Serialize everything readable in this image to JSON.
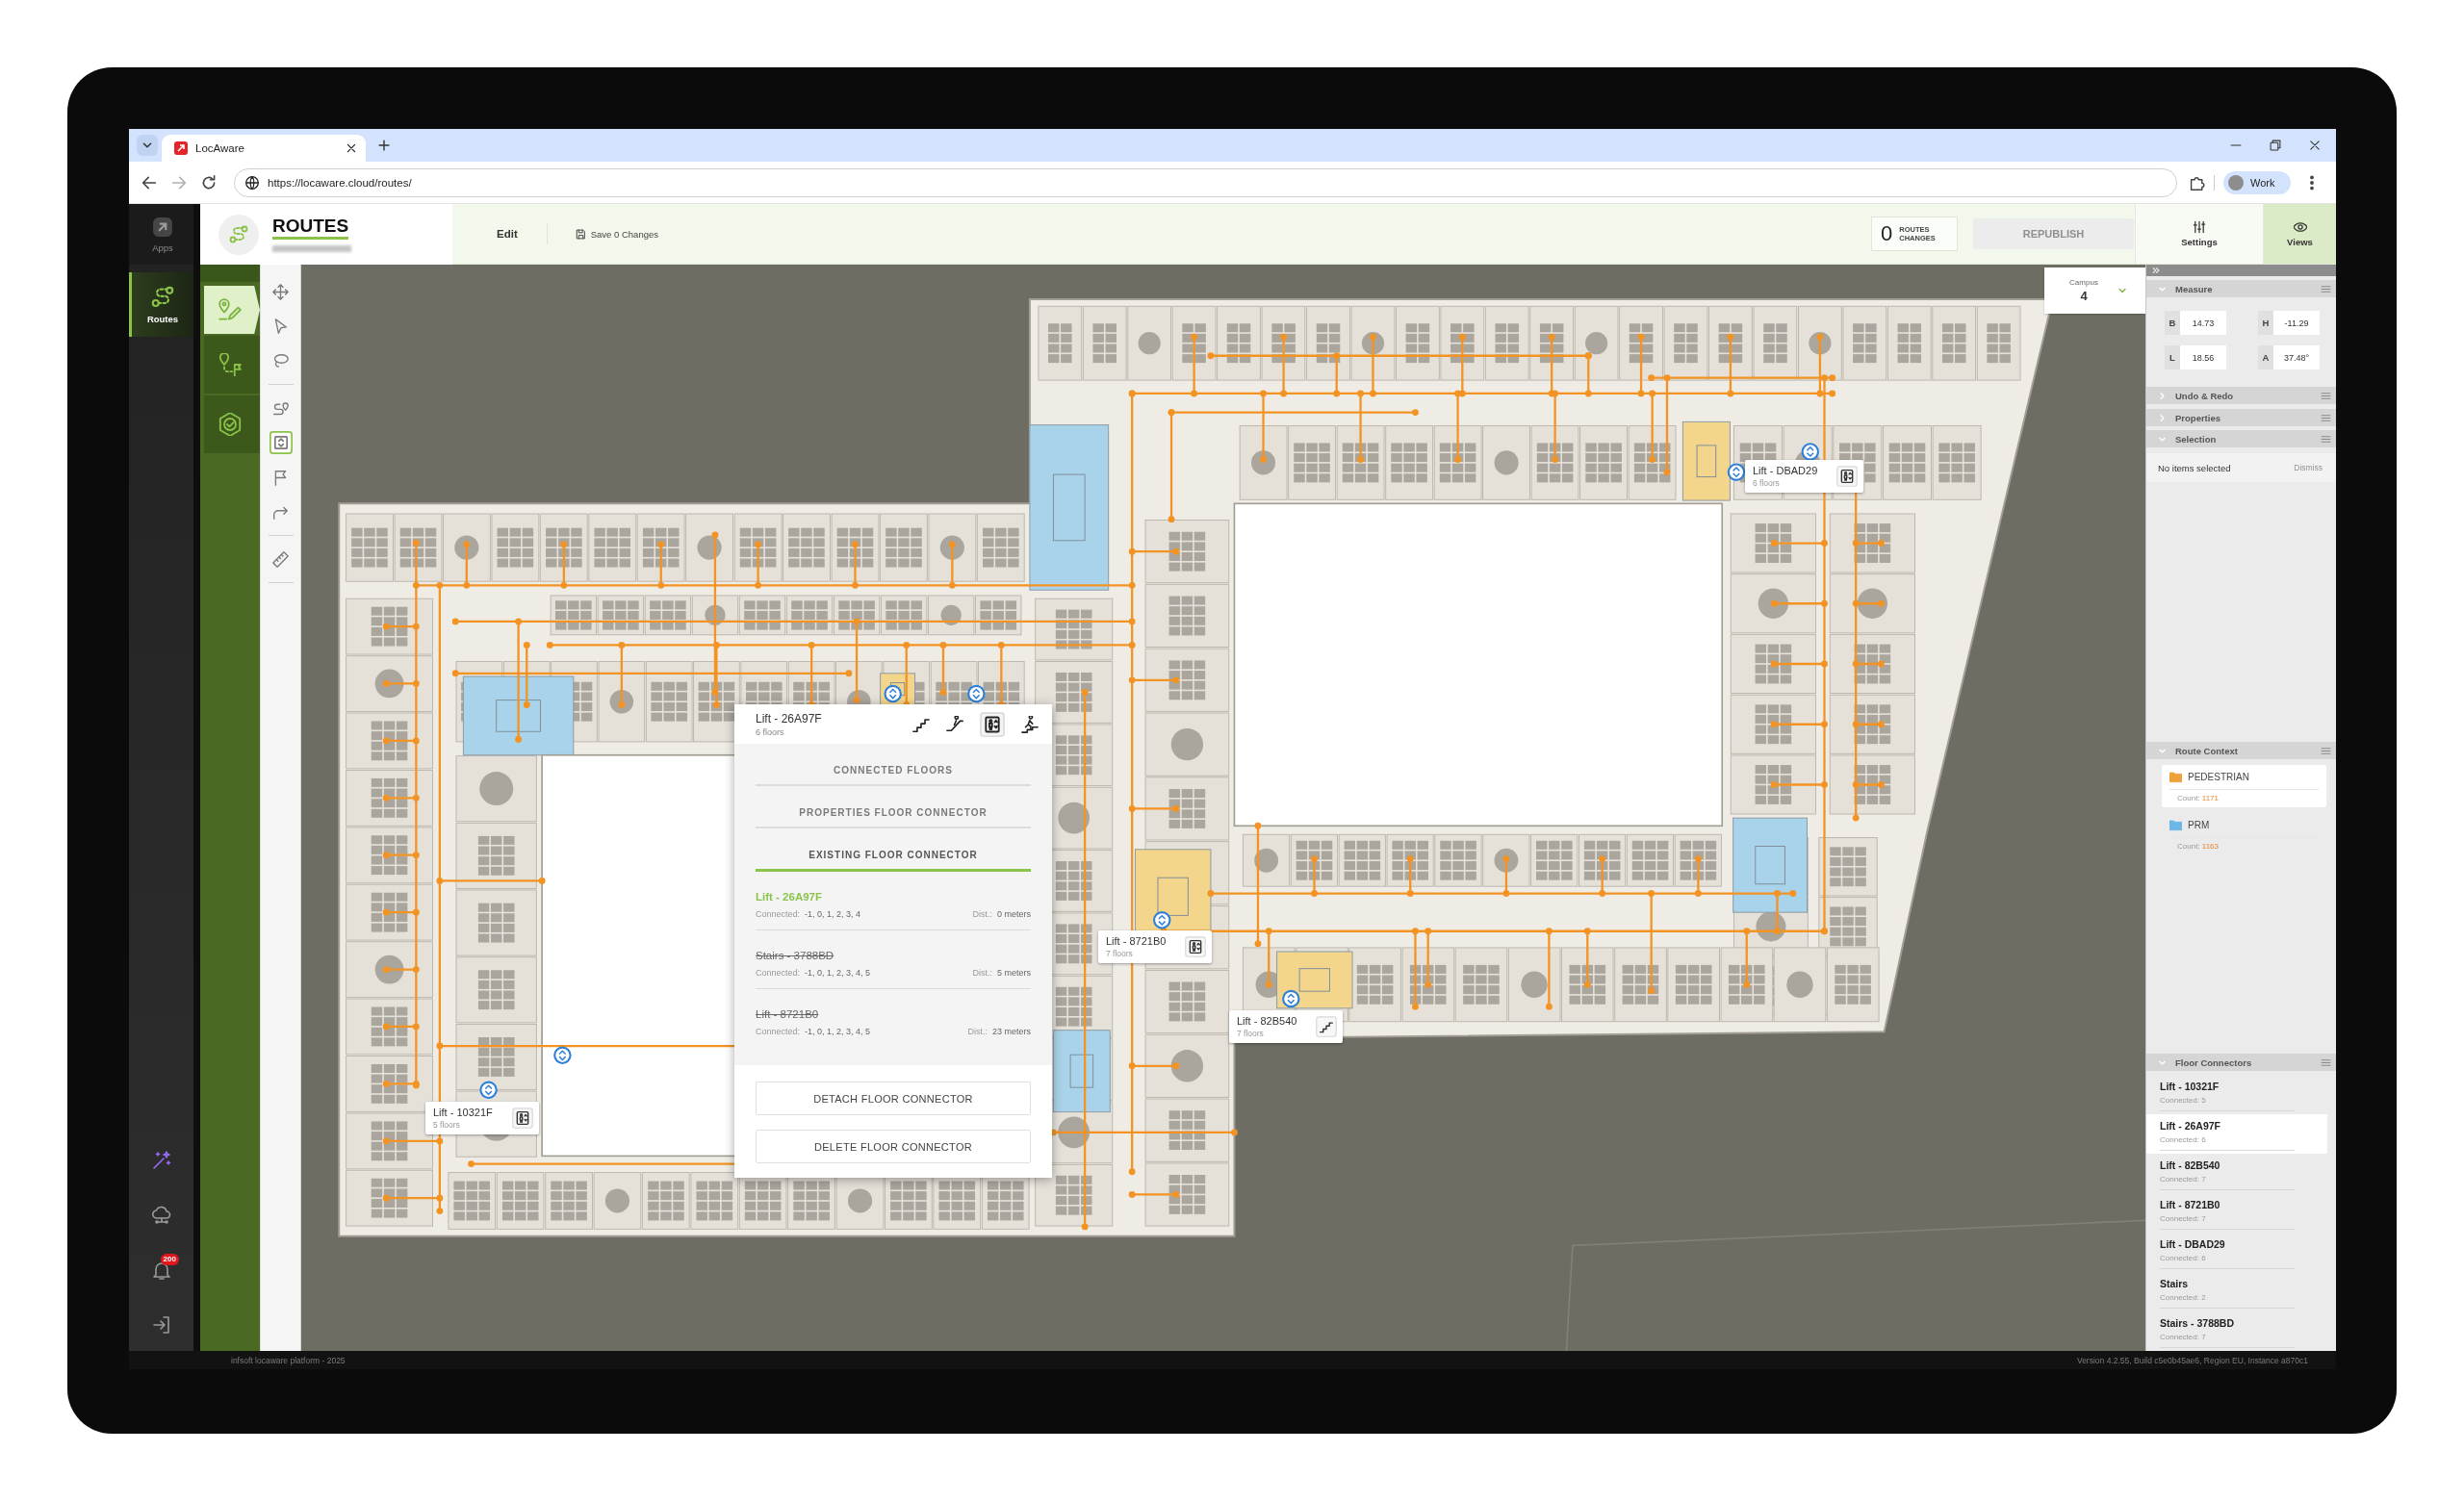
{
  "browser": {
    "tab_title": "LocAware",
    "url": "https://locaware.cloud/routes/",
    "profile": "Work"
  },
  "nav": {
    "items": [
      {
        "label": "Apps",
        "selected": false
      },
      {
        "label": "Routes",
        "selected": true
      }
    ],
    "notification_count": "200"
  },
  "header": {
    "title": "ROUTES",
    "edit": "Edit",
    "save": "Save 0 Changes",
    "changes_count": "0",
    "changes_label": "ROUTES CHANGES",
    "republish": {
      "label": "REPUBLISH",
      "disabled": true
    },
    "view_buttons": [
      {
        "label": "Settings",
        "selected": false
      },
      {
        "label": "Views",
        "selected": true
      }
    ]
  },
  "modes": [
    {
      "selected": true
    },
    {
      "selected": false
    },
    {
      "selected": false
    }
  ],
  "tools": [
    {
      "selected": false
    },
    {
      "selected": false
    },
    {
      "selected": false
    },
    {
      "selected": false
    },
    {
      "selected": true
    },
    {
      "selected": false
    },
    {
      "selected": false
    },
    {
      "selected": false
    }
  ],
  "map": {
    "campus": {
      "label": "Campus",
      "value": "4"
    },
    "labels": [
      {
        "kind": "lift",
        "name": "Lift - DBAD29",
        "floors": "6 floors"
      },
      {
        "kind": "lift",
        "name": "Lift - 8721B0",
        "floors": "7 floors"
      },
      {
        "kind": "stairs",
        "name": "Lift - 82B540",
        "floors": "7 floors"
      },
      {
        "kind": "lift",
        "name": "Lift - 10321F",
        "floors": "5 floors"
      }
    ]
  },
  "popup": {
    "title": "Lift - 26A97F",
    "subtitle": "6 floors",
    "modes": [
      {
        "selected": false
      },
      {
        "selected": false
      },
      {
        "selected": true
      },
      {
        "selected": false
      }
    ],
    "tabs": [
      {
        "label": "CONNECTED FLOORS",
        "selected": false
      },
      {
        "label": "PROPERTIES FLOOR CONNECTOR",
        "selected": false
      },
      {
        "label": "EXISTING FLOOR CONNECTOR",
        "selected": true
      }
    ],
    "connectors": [
      {
        "name": "Lift - 26A97F",
        "current": true,
        "connected_label": "Connected:",
        "connected": "-1, 0, 1, 2, 3, 4",
        "distance_label": "Dist.:",
        "distance": "0 meters"
      },
      {
        "name": "Stairs - 3788BD",
        "current": false,
        "connected_label": "Connected:",
        "connected": "-1, 0, 1, 2, 3, 4, 5",
        "distance_label": "Dist.:",
        "distance": "5 meters"
      },
      {
        "name": "Lift - 8721B0",
        "current": false,
        "connected_label": "Connected:",
        "connected": "-1, 0, 1, 2, 3, 4, 5",
        "distance_label": "Dist.:",
        "distance": "23 meters"
      }
    ],
    "buttons": [
      "DETACH FLOOR CONNECTOR",
      "DELETE FLOOR CONNECTOR"
    ]
  },
  "panel": {
    "sections": [
      {
        "kind": "measure",
        "title": "Measure",
        "expanded": true,
        "fields": [
          {
            "label": "B",
            "value": "14.73"
          },
          {
            "label": "H",
            "value": "-11.29"
          },
          {
            "label": "L",
            "value": "18.56"
          },
          {
            "label": "A",
            "value": "37.48°"
          }
        ]
      },
      {
        "kind": "plain",
        "title": "Undo & Redo",
        "expanded": false
      },
      {
        "kind": "plain",
        "title": "Properties",
        "expanded": false
      },
      {
        "kind": "selection",
        "title": "Selection",
        "expanded": true,
        "message": "No items selected",
        "action": {
          "label": "Dismiss",
          "disabled": true
        }
      },
      {
        "kind": "contexts",
        "title": "Route Context",
        "expanded": true,
        "items": [
          {
            "name": "PEDESTRIAN",
            "count_label": "Count:",
            "count": "1171",
            "color": "#f0a03a",
            "selected": true
          },
          {
            "name": "PRM",
            "count_label": "Count:",
            "count": "1163",
            "color": "#6cb6e8",
            "selected": false
          }
        ]
      },
      {
        "kind": "connectors",
        "title": "Floor Connectors",
        "expanded": true,
        "items": [
          {
            "name": "Lift - 10321F",
            "connected": "Connected: 5",
            "selected": false
          },
          {
            "name": "Lift - 26A97F",
            "connected": "Connected: 6",
            "selected": true
          },
          {
            "name": "Lift - 82B540",
            "connected": "Connected: 7",
            "selected": false
          },
          {
            "name": "Lift - 8721B0",
            "connected": "Connected: 7",
            "selected": false
          },
          {
            "name": "Lift - DBAD29",
            "connected": "Connected: 6",
            "selected": false
          },
          {
            "name": "Stairs",
            "connected": "Connected: 2",
            "selected": false
          },
          {
            "name": "Stairs - 3788BD",
            "connected": "Connected: 7",
            "selected": false
          }
        ]
      }
    ]
  },
  "status_bar": {
    "left": "infsoft locaware platform - 2025",
    "right": "Version 4.2.55, Build c5e0b45ae6, Region EU, Instance a870c1"
  }
}
